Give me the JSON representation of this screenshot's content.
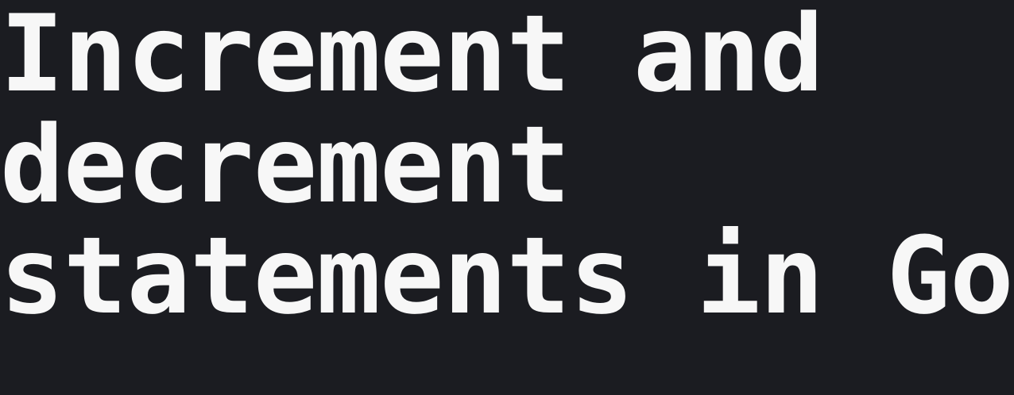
{
  "page": {
    "background": "#1b1c21",
    "text_color": "#f7f7f7",
    "title_lines": [
      "Increment and",
      "decrement",
      "statements in Go"
    ]
  }
}
